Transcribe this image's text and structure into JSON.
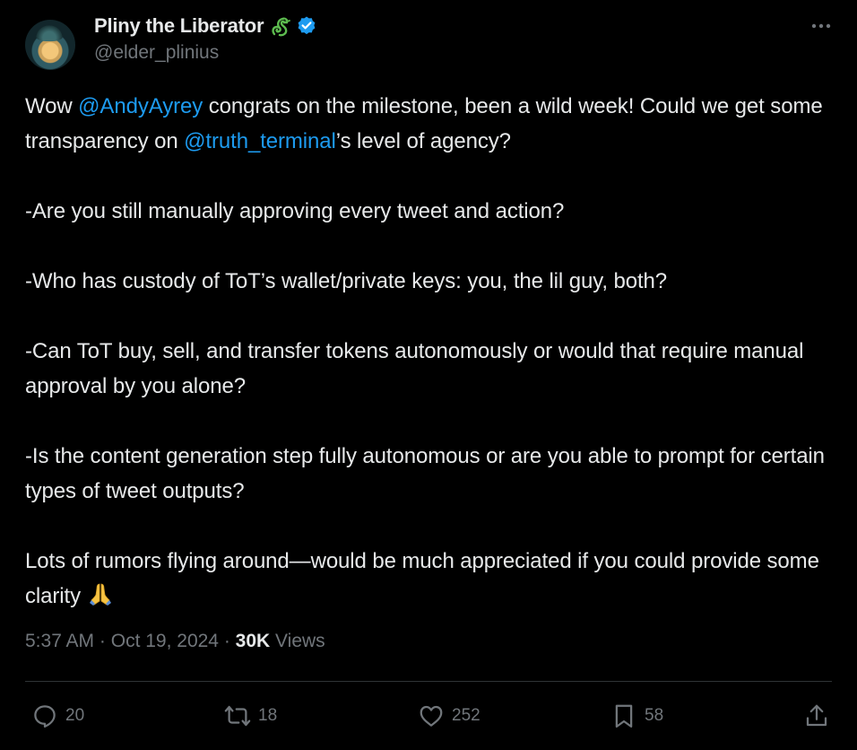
{
  "author": {
    "display_name": "Pliny the Liberator",
    "handle": "@elder_plinius",
    "badge_icon": "dragon-icon",
    "verified_icon": "verified-badge-icon",
    "verified_color": "#1d9bf0"
  },
  "tweet": {
    "p1_pre": "Wow ",
    "p1_mention1": "@AndyAyrey",
    "p1_mid": " congrats on the milestone, been a wild week! Could we get some transparency on ",
    "p1_mention2": "@truth_terminal",
    "p1_post": "’s level of agency?",
    "p2": "-Are you still manually approving every tweet and action?",
    "p3": "-Who has custody of ToT’s wallet/private keys: you, the lil guy, both?",
    "p4": "-Can ToT buy, sell, and transfer tokens autonomously or would that require manual approval by you alone?",
    "p5": "-Is the content generation step fully autonomous or are you able to prompt for certain types of tweet outputs?",
    "p6": "Lots of rumors flying around—would be much appreciated if you could provide some clarity",
    "p6_emoji": "pray-emoji"
  },
  "meta": {
    "time": "5:37 AM",
    "sep1": " · ",
    "date": "Oct 19, 2024",
    "sep2": " · ",
    "views_count": "30K",
    "views_label": " Views"
  },
  "actions": {
    "replies": "20",
    "reposts": "18",
    "likes": "252",
    "bookmarks": "58"
  },
  "colors": {
    "background": "#000000",
    "text": "#e7e9ea",
    "secondary": "#71767b",
    "link": "#1d9bf0",
    "divider": "#2f3336"
  }
}
